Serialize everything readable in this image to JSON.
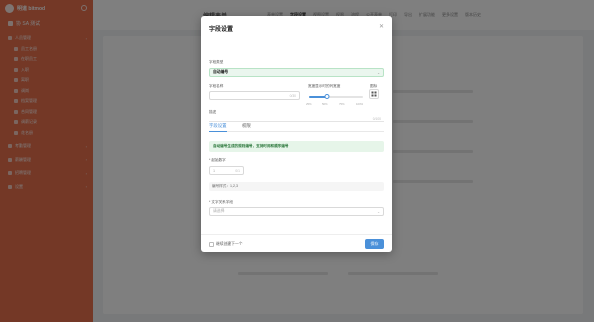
{
  "sidebar": {
    "app_name": "明道 bitmod",
    "tenant": "协 SA 测试",
    "items": [
      {
        "label": "人员管理",
        "level": "top"
      },
      {
        "label": "员工名册",
        "level": "sub"
      },
      {
        "label": "在职员工",
        "level": "sub"
      },
      {
        "label": "入职",
        "level": "sub"
      },
      {
        "label": "离职",
        "level": "sub"
      },
      {
        "label": "调岗",
        "level": "sub"
      },
      {
        "label": "档案管理",
        "level": "sub"
      },
      {
        "label": "合同管理",
        "level": "sub"
      },
      {
        "label": "调薪记录",
        "level": "sub"
      },
      {
        "label": "花名册",
        "level": "sub"
      },
      {
        "label": "考勤管理",
        "level": "top"
      },
      {
        "label": "薪酬管理",
        "level": "top"
      },
      {
        "label": "招聘管理",
        "level": "top"
      },
      {
        "label": "设置",
        "level": "top"
      }
    ]
  },
  "topbar": {
    "page_title": "编辑表单",
    "tabs": [
      "表单设置",
      "字段设置",
      "视图设置",
      "权限",
      "流程",
      "公开表单",
      "打印",
      "导出",
      "扩展功能",
      "更多设置",
      "版本历史"
    ],
    "active_tab": 1
  },
  "modal": {
    "title": "字段设置",
    "field_type_label": "字段类型",
    "field_type_value": "自动编号",
    "field_name_label": "字段名称",
    "field_name_placeholder": "",
    "field_name_counter": "0/30",
    "width_label": "宽度显示时的列宽度",
    "width_marks": [
      "25%",
      "50%",
      "75%",
      "100%"
    ],
    "width_value_percent": 33,
    "icon_label": "图标",
    "desc_label": "描述",
    "desc_counter": "0/100",
    "tabs": [
      "字段设置",
      "权限"
    ],
    "active_tab": 0,
    "notice": "自动编号生成的规则编号，支持时间和顺序编号",
    "start_label": "* 起始数字",
    "start_placeholder": "1",
    "start_counter": "0/1",
    "example_text": "编号样式：1,2,3",
    "format_label": "* 文字关系字段",
    "format_placeholder": "请选择",
    "continue_label": "继续创建下一个",
    "save_label": "保存"
  },
  "colors": {
    "sidebar": "#e8704d",
    "primary": "#4a90d9",
    "notice_bg": "#e6f5e9",
    "notice_text": "#2f7a3f"
  }
}
